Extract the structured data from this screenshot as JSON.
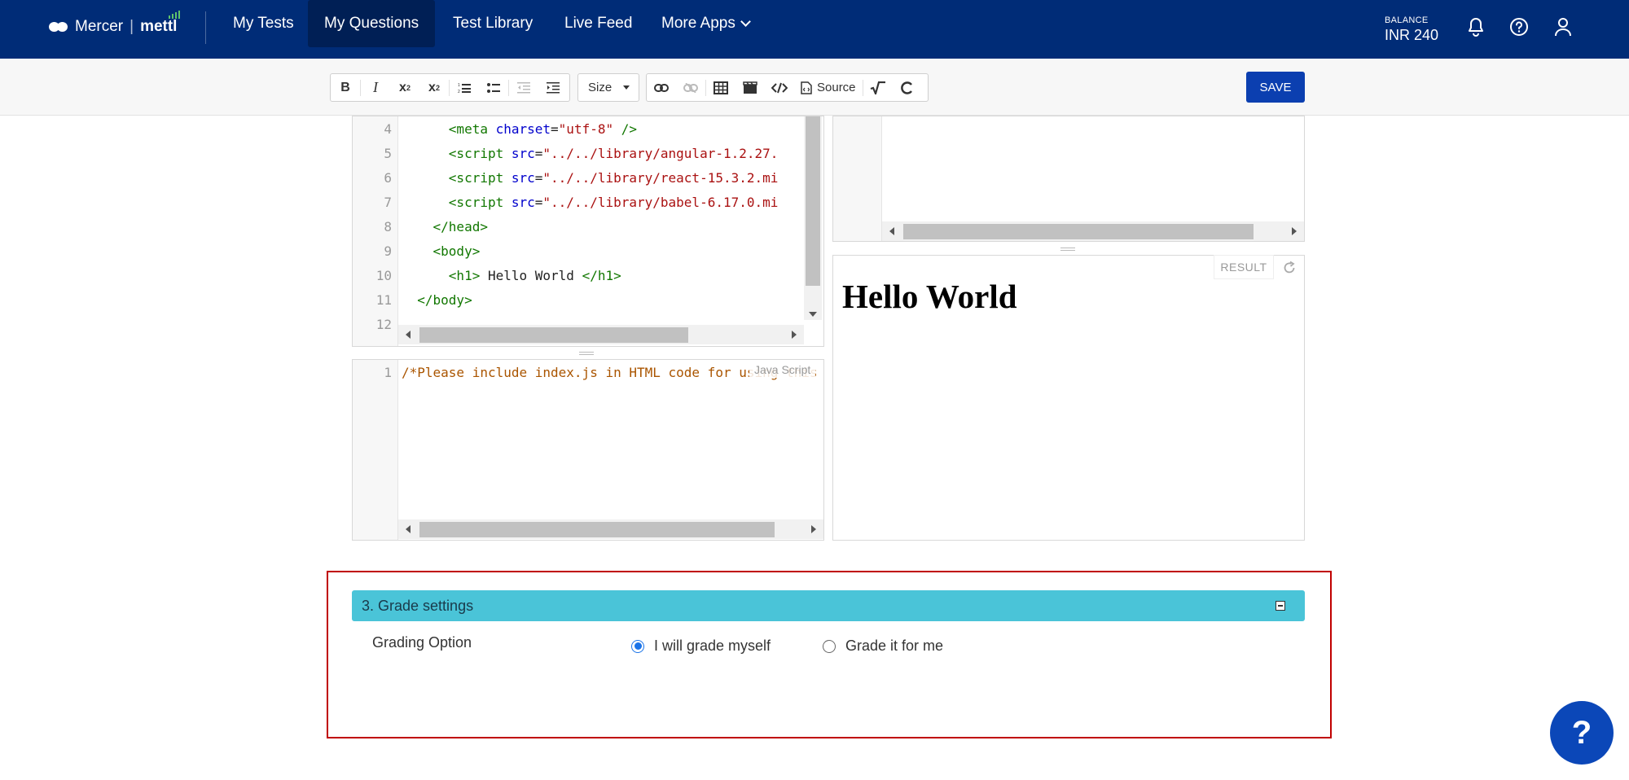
{
  "brand": {
    "company": "Mercer",
    "product": "mettl"
  },
  "nav": {
    "items": [
      {
        "label": "My Tests"
      },
      {
        "label": "My Questions"
      },
      {
        "label": "Test Library"
      },
      {
        "label": "Live Feed"
      },
      {
        "label": "More Apps"
      }
    ],
    "balance_label": "BALANCE",
    "balance_value": "INR 240"
  },
  "toolbar": {
    "size_label": "Size",
    "source_label": "Source",
    "save_label": "SAVE"
  },
  "html_editor": {
    "lines": [
      {
        "n": "4",
        "indent": "      ",
        "parts": [
          [
            "tag",
            "<meta "
          ],
          [
            "attr",
            "charset"
          ],
          [
            "txt",
            "="
          ],
          [
            "str",
            "\"utf-8\""
          ],
          [
            "tag",
            " />"
          ]
        ]
      },
      {
        "n": "5",
        "indent": "      ",
        "parts": [
          [
            "tag",
            "<script "
          ],
          [
            "attr",
            "src"
          ],
          [
            "txt",
            "="
          ],
          [
            "str",
            "\"../../library/angular-1.2.27."
          ]
        ]
      },
      {
        "n": "6",
        "indent": "      ",
        "parts": [
          [
            "tag",
            "<script "
          ],
          [
            "attr",
            "src"
          ],
          [
            "txt",
            "="
          ],
          [
            "str",
            "\"../../library/react-15.3.2.mi"
          ]
        ]
      },
      {
        "n": "7",
        "indent": "      ",
        "parts": [
          [
            "tag",
            "<script "
          ],
          [
            "attr",
            "src"
          ],
          [
            "txt",
            "="
          ],
          [
            "str",
            "\"../../library/babel-6.17.0.mi"
          ]
        ]
      },
      {
        "n": "8",
        "indent": "    ",
        "parts": [
          [
            "tag",
            "</head>"
          ]
        ]
      },
      {
        "n": "9",
        "indent": "    ",
        "parts": [
          [
            "tag",
            "<body>"
          ]
        ]
      },
      {
        "n": "10",
        "indent": "      ",
        "parts": [
          [
            "tag",
            "<h1>"
          ],
          [
            "txt",
            " Hello World "
          ],
          [
            "tag",
            "</h1>"
          ]
        ]
      },
      {
        "n": "11",
        "indent": "  ",
        "parts": [
          [
            "tag",
            "</body>"
          ]
        ]
      },
      {
        "n": "12",
        "indent": "",
        "parts": []
      }
    ]
  },
  "js_editor": {
    "line_number": "1",
    "code": "/*Please include index.js in HTML code for using this",
    "mode_label": "Java Script"
  },
  "result": {
    "label": "RESULT",
    "heading": "Hello World"
  },
  "grade": {
    "title": "3. Grade settings",
    "option_label": "Grading Option",
    "options": [
      {
        "label": "I will grade myself",
        "checked": true
      },
      {
        "label": "Grade it for me",
        "checked": false
      }
    ]
  },
  "help_fab_label": "?"
}
